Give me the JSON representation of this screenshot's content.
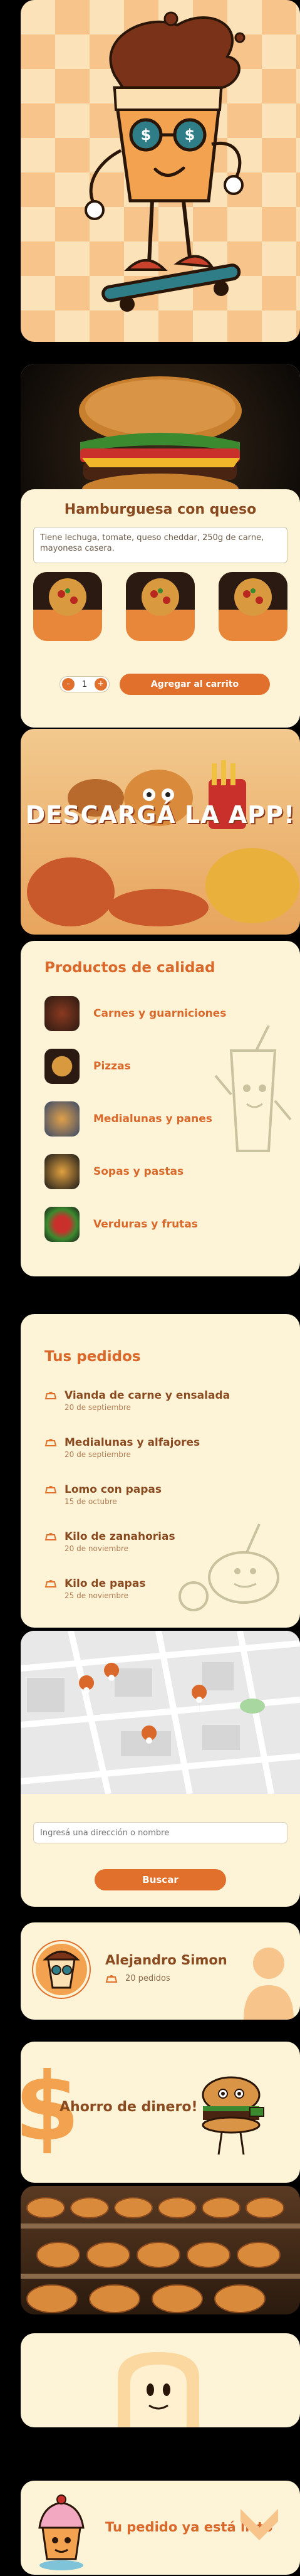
{
  "product": {
    "title": "Hamburguesa con queso",
    "description": "Tiene lechuga, tomate, queso cheddar, 250g de carne, mayonesa casera.",
    "quantity": "1",
    "minus": "-",
    "plus": "+",
    "add_to_cart": "Agregar al carrito"
  },
  "promo": {
    "download": "DESCARGÁ LA APP!"
  },
  "products_section": {
    "title": "Productos de calidad",
    "items": [
      {
        "label": "Carnes y guarniciones"
      },
      {
        "label": "Pizzas"
      },
      {
        "label": "Medialunas y panes"
      },
      {
        "label": "Sopas y pastas"
      },
      {
        "label": "Verduras y frutas"
      }
    ]
  },
  "orders_section": {
    "title": "Tus pedidos",
    "orders": [
      {
        "title": "Vianda de carne y ensalada",
        "date": "20 de septiembre"
      },
      {
        "title": "Medialunas y alfajores",
        "date": "20 de septiembre"
      },
      {
        "title": "Lomo con papas",
        "date": "15 de octubre"
      },
      {
        "title": "Kilo de zanahorias",
        "date": "20 de noviembre"
      },
      {
        "title": "Kilo de papas",
        "date": "25 de noviembre"
      }
    ]
  },
  "map_section": {
    "placeholder": "Ingresá una dirección o nombre",
    "search": "Buscar"
  },
  "profile": {
    "name": "Alejandro Simon",
    "orders": "20 pedidos"
  },
  "savings": {
    "title": "Ahorro de dinero!",
    "dollar": "$"
  },
  "ready": {
    "title": "Tu pedido ya está listo"
  },
  "colors": {
    "accent": "#e0702b",
    "cream": "#fdf3d6",
    "brown": "#8a4a1f"
  }
}
